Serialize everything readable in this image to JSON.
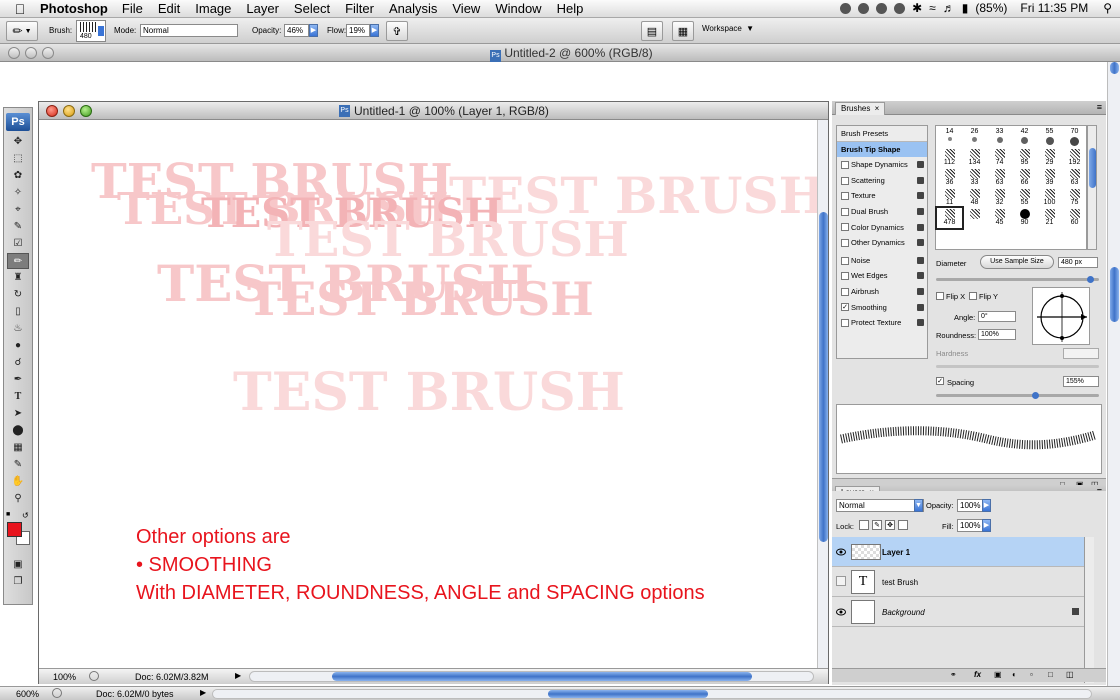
{
  "menubar": {
    "app_name": "Photoshop",
    "items": [
      "File",
      "Edit",
      "Image",
      "Layer",
      "Select",
      "Filter",
      "Analysis",
      "View",
      "Window",
      "Help"
    ],
    "battery": "(85%)",
    "clock": "Fri 11:35 PM"
  },
  "options_bar": {
    "brush_label": "Brush:",
    "brush_size": "480",
    "mode_label": "Mode:",
    "mode_value": "Normal",
    "opacity_label": "Opacity:",
    "opacity_value": "46%",
    "flow_label": "Flow:",
    "flow_value": "19%",
    "workspace_label": "Workspace"
  },
  "doc2": {
    "title": "Untitled-2 @ 600% (RGB/8)",
    "zoom": "600%",
    "doc_info": "Doc: 6.02M/0 bytes"
  },
  "doc1": {
    "title": "Untitled-1 @ 100% (Layer 1, RGB/8)",
    "zoom": "100%",
    "doc_info": "Doc: 6.02M/3.82M",
    "watermark_text": "TEST BRUSH",
    "notes": [
      "Other options are",
      "• SMOOTHING",
      "With DIAMETER, ROUNDNESS, ANGLE and SPACING options"
    ]
  },
  "brushes_panel": {
    "tab": "Brushes",
    "options": [
      {
        "label": "Brush Presets",
        "checkbox": false,
        "checked": false,
        "lock": false,
        "header": true
      },
      {
        "label": "Brush Tip Shape",
        "checkbox": false,
        "checked": false,
        "lock": false,
        "selected": true
      },
      {
        "label": "Shape Dynamics",
        "checkbox": true,
        "checked": false,
        "lock": true
      },
      {
        "label": "Scattering",
        "checkbox": true,
        "checked": false,
        "lock": true
      },
      {
        "label": "Texture",
        "checkbox": true,
        "checked": false,
        "lock": true
      },
      {
        "label": "Dual Brush",
        "checkbox": true,
        "checked": false,
        "lock": true
      },
      {
        "label": "Color Dynamics",
        "checkbox": true,
        "checked": false,
        "lock": true
      },
      {
        "label": "Other Dynamics",
        "checkbox": true,
        "checked": false,
        "lock": true
      },
      {
        "label": "Noise",
        "checkbox": true,
        "checked": false,
        "lock": true
      },
      {
        "label": "Wet Edges",
        "checkbox": true,
        "checked": false,
        "lock": true
      },
      {
        "label": "Airbrush",
        "checkbox": true,
        "checked": false,
        "lock": true
      },
      {
        "label": "Smoothing",
        "checkbox": true,
        "checked": true,
        "lock": true
      },
      {
        "label": "Protect Texture",
        "checkbox": true,
        "checked": false,
        "lock": true
      }
    ],
    "brush_sizes": [
      "14",
      "26",
      "33",
      "42",
      "55",
      "70",
      "112",
      "134",
      "74",
      "95",
      "29",
      "192",
      "36",
      "33",
      "63",
      "66",
      "39",
      "63",
      "11",
      "48",
      "32",
      "55",
      "100",
      "75",
      "478",
      "",
      "45",
      "90",
      "21",
      "60"
    ],
    "diameter_label": "Diameter",
    "use_sample_size": "Use Sample Size",
    "diameter_value": "480 px",
    "diameter_fraction": 0.96,
    "flip_x": "Flip X",
    "flip_y": "Flip Y",
    "angle_label": "Angle:",
    "angle_value": "0°",
    "roundness_label": "Roundness:",
    "roundness_value": "100%",
    "hardness_label": "Hardness",
    "spacing_label": "Spacing",
    "spacing_value": "155%",
    "spacing_fraction": 0.62
  },
  "layers_panel": {
    "tab": "Layers",
    "blend_mode": "Normal",
    "opacity_label": "Opacity:",
    "opacity_value": "100%",
    "lock_label": "Lock:",
    "fill_label": "Fill:",
    "fill_value": "100%",
    "layers": [
      {
        "name": "Layer 1",
        "selected": true,
        "visible": true,
        "kind": "pixel"
      },
      {
        "name": "test Brush",
        "selected": false,
        "visible": false,
        "kind": "text"
      },
      {
        "name": "Background",
        "selected": false,
        "visible": true,
        "kind": "background"
      }
    ]
  },
  "colors": {
    "foreground": "#e8141d",
    "background": "#ffffff",
    "accent": "#3f73c8",
    "note_text": "#e8141d",
    "watermark": "#f7c7c9"
  }
}
